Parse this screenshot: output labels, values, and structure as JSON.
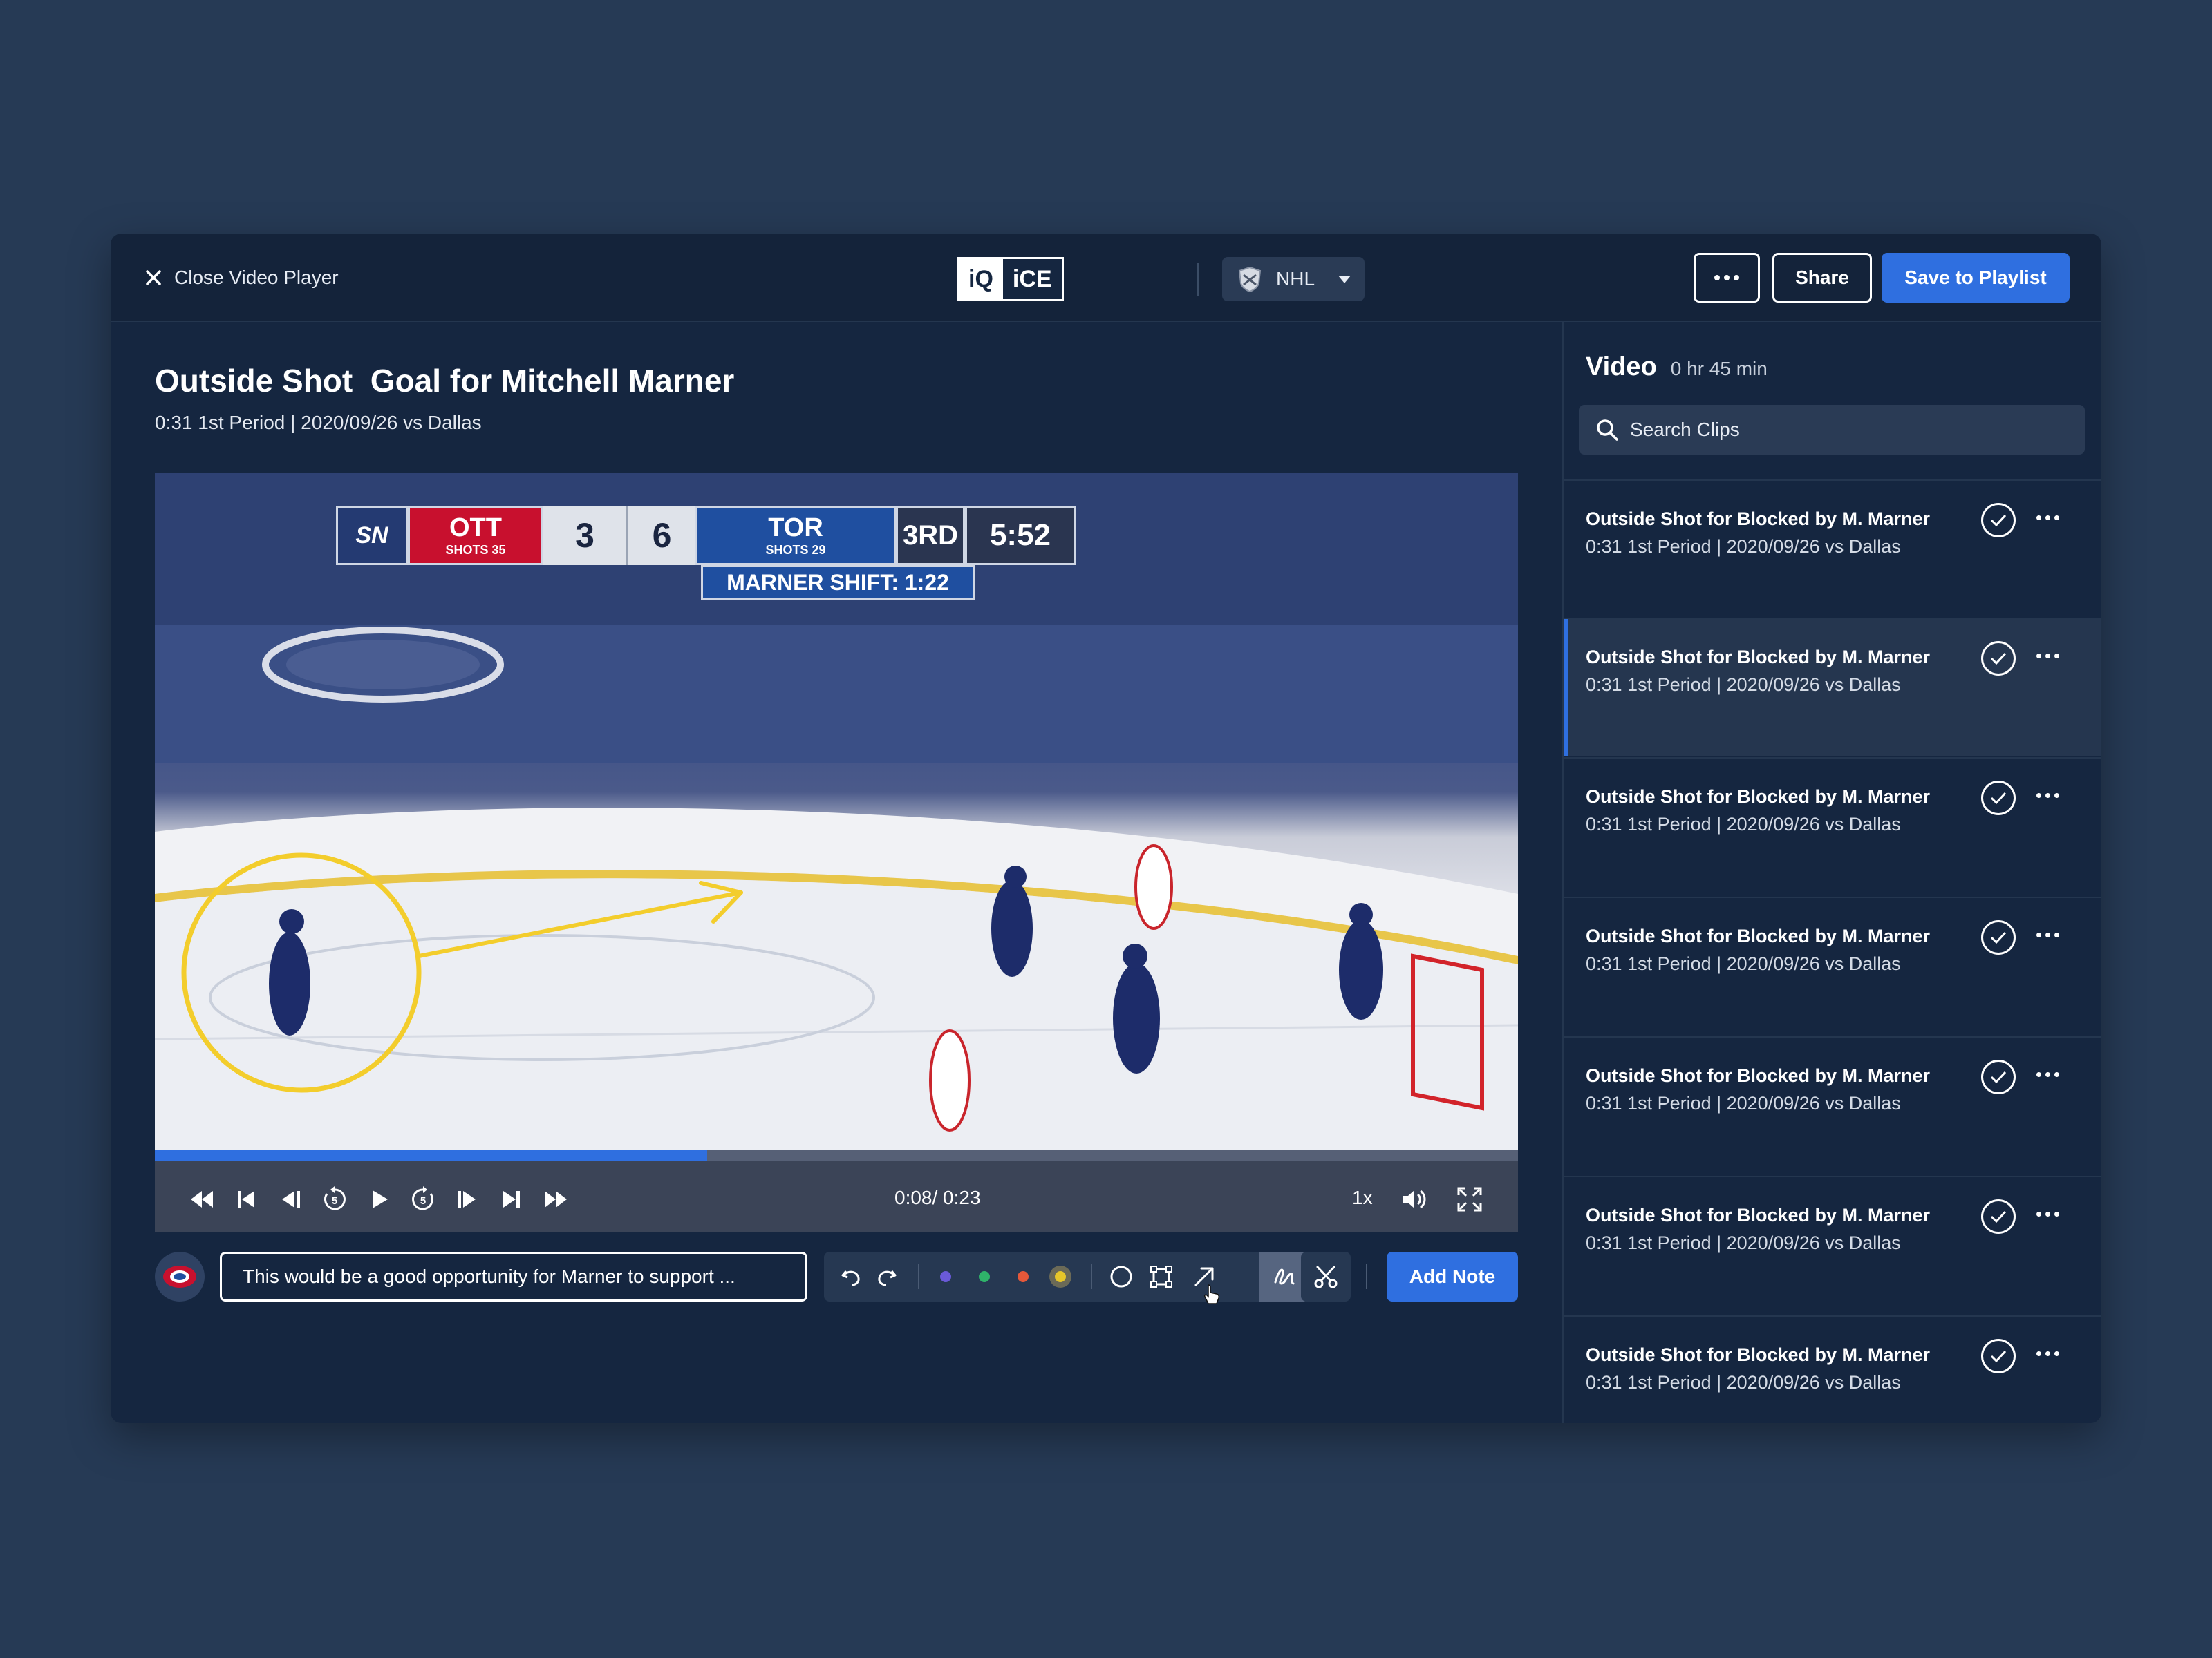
{
  "header": {
    "close_label": "Close Video Player",
    "logo_left": "iQ",
    "logo_right": "iCE",
    "league": "NHL",
    "share_label": "Share",
    "save_label": "Save to Playlist"
  },
  "main": {
    "title": "Outside Shot  Goal for Mitchell Marner",
    "subtitle": "0:31 1st Period | 2020/09/26 vs Dallas"
  },
  "video": {
    "time": "0:08/ 0:23",
    "progress": 0.405,
    "speed": "1x",
    "scoreboard": {
      "network": "SN",
      "away_team": "OTT",
      "away_shots_label": "SHOTS",
      "away_shots": "35",
      "away_score": "3",
      "home_score": "6",
      "home_team": "TOR",
      "home_shots_label": "SHOTS",
      "home_shots": "29",
      "period": "3RD",
      "clock": "5:52",
      "shift": "MARNER SHIFT: 1:22"
    }
  },
  "note": {
    "text": "This would be a good opportunity for Marner to support ...",
    "add_label": "Add Note",
    "colors": [
      "#6a5ad8",
      "#2fb36a",
      "#e5583a",
      "#e6c62a"
    ]
  },
  "sidebar": {
    "title": "Video",
    "duration": "0 hr 45 min",
    "search_placeholder": "Search Clips",
    "clips": [
      {
        "title": "Outside Shot for Blocked by M. Marner",
        "subtitle": "0:31 1st Period | 2020/09/26 vs Dallas"
      },
      {
        "title": "Outside Shot for Blocked by M. Marner",
        "subtitle": "0:31 1st Period | 2020/09/26 vs Dallas"
      },
      {
        "title": "Outside Shot for Blocked by M. Marner",
        "subtitle": "0:31 1st Period | 2020/09/26 vs Dallas"
      },
      {
        "title": "Outside Shot for Blocked by M. Marner",
        "subtitle": "0:31 1st Period | 2020/09/26 vs Dallas"
      },
      {
        "title": "Outside Shot for Blocked by M. Marner",
        "subtitle": "0:31 1st Period | 2020/09/26 vs Dallas"
      },
      {
        "title": "Outside Shot for Blocked by M. Marner",
        "subtitle": "0:31 1st Period | 2020/09/26 vs Dallas"
      },
      {
        "title": "Outside Shot for Blocked by M. Marner",
        "subtitle": "0:31 1st Period | 2020/09/26 vs Dallas"
      }
    ],
    "active_index": 1
  }
}
